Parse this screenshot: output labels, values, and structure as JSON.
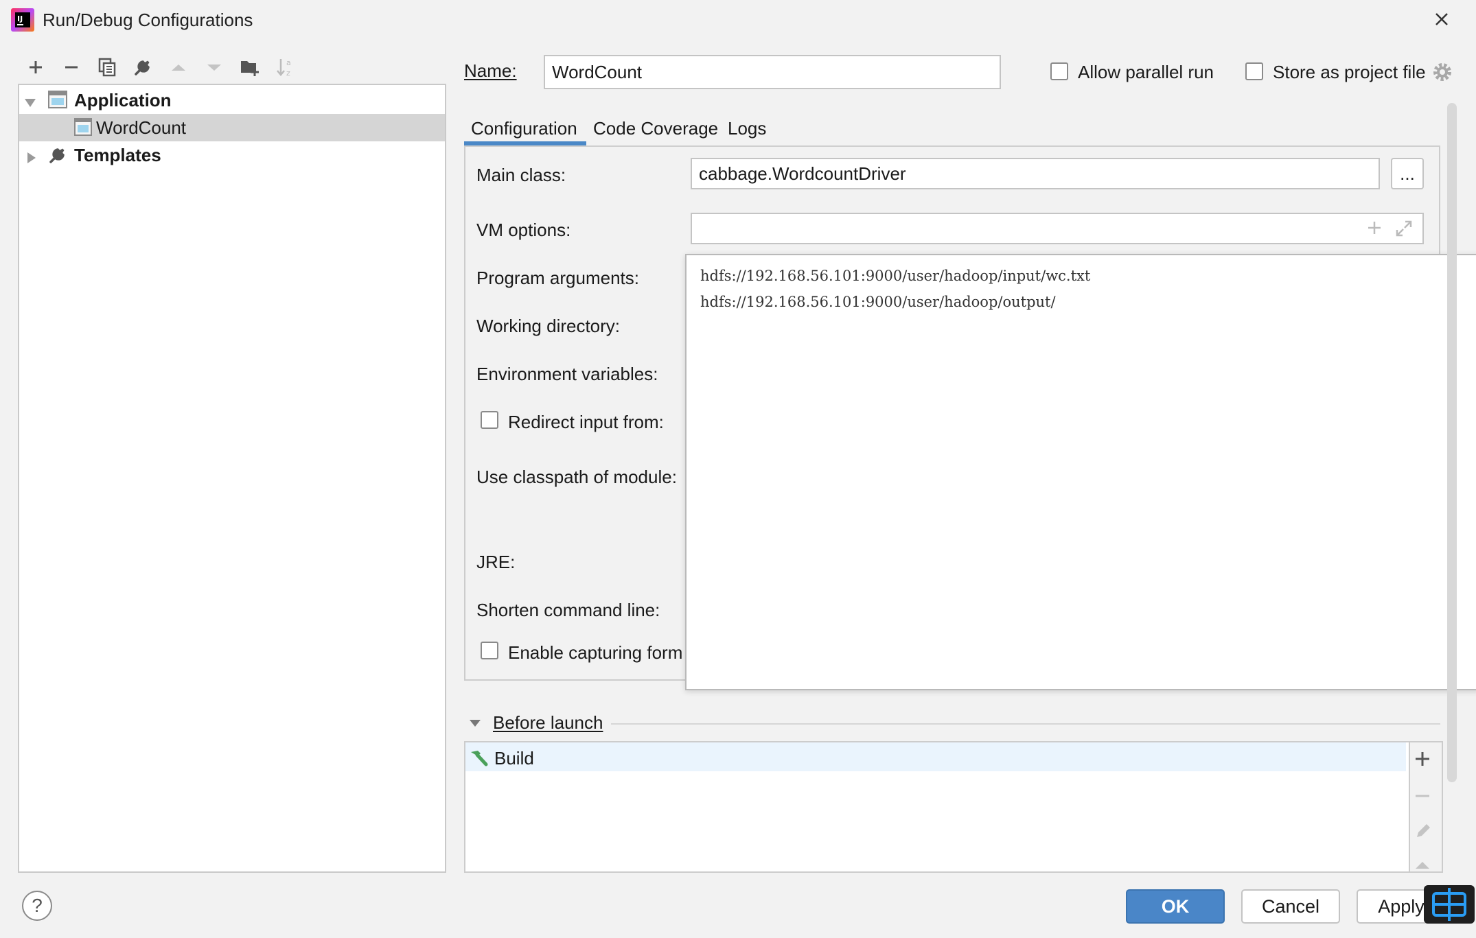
{
  "window": {
    "title": "Run/Debug Configurations",
    "app_icon": "intellij-idea-icon",
    "close_icon": "close-icon"
  },
  "toolbar": {
    "icons": [
      "add-icon",
      "remove-icon",
      "copy-icon",
      "wrench-icon",
      "move-up-icon",
      "move-down-icon",
      "new-folder-icon",
      "sort-alpha-icon"
    ]
  },
  "tree": {
    "items": [
      {
        "label": "Application",
        "bold": true,
        "expanded": true
      },
      {
        "label": "WordCount",
        "bold": false,
        "selected": true
      },
      {
        "label": "Templates",
        "bold": true,
        "expanded": false
      }
    ]
  },
  "header": {
    "name_label": "Name:",
    "name_value": "WordCount",
    "allow_parallel_label": "Allow parallel run",
    "store_project_label": "Store as project file"
  },
  "tabs": [
    {
      "label": "Configuration",
      "active": true
    },
    {
      "label": "Code Coverage",
      "active": false
    },
    {
      "label": "Logs",
      "active": false
    }
  ],
  "config": {
    "main_class_label": "Main class:",
    "main_class_value": "cabbage.WordcountDriver",
    "browse_label": "...",
    "vm_options_label": "VM options:",
    "vm_options_value": "",
    "program_args_label": "Program arguments:",
    "working_dir_label": "Working directory:",
    "env_vars_label": "Environment variables:",
    "redirect_input_label": "Redirect input from:",
    "classpath_label": "Use classpath of module:",
    "jre_label": "JRE:",
    "shorten_label": "Shorten command line:",
    "enable_capturing_label": "Enable capturing form"
  },
  "program_args_popup": {
    "lines": [
      "hdfs://192.168.56.101:9000/user/hadoop/input/wc.txt",
      "hdfs://192.168.56.101:9000/user/hadoop/output/"
    ]
  },
  "before_launch": {
    "title": "Before launch",
    "tasks": [
      {
        "label": "Build",
        "icon": "hammer-icon"
      }
    ]
  },
  "footer": {
    "help_label": "?",
    "ok_label": "OK",
    "cancel_label": "Cancel",
    "apply_label": "Apply"
  },
  "colors": {
    "accent": "#4a86c8",
    "selection": "#d5d5d5",
    "build_icon": "#4aa05a"
  }
}
